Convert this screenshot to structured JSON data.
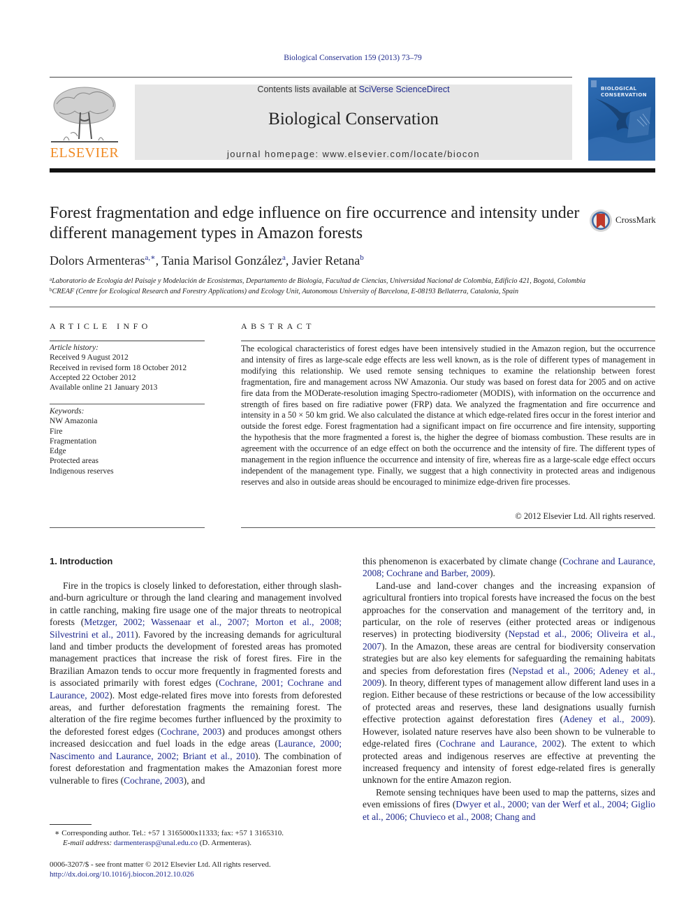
{
  "header": {
    "citation": "Biological Conservation 159 (2013) 73–79",
    "contents_prefix": "Contents lists available at ",
    "contents_link": "SciVerse ScienceDirect",
    "journal_name": "Biological Conservation",
    "homepage_prefix": "journal homepage: ",
    "homepage_url": "www.elsevier.com/locate/biocon",
    "publisher_logo_text": "ELSEVIER",
    "cover_title_line1": "BIOLOGICAL",
    "cover_title_line2": "CONSERVATION",
    "crossmark_label": "CrossMark"
  },
  "article": {
    "title": "Forest fragmentation and edge influence on fire occurrence and intensity under different management types in Amazon forests",
    "authors": [
      {
        "name": "Dolors Armenteras",
        "sup": "a,∗"
      },
      {
        "name": "Tania Marisol González",
        "sup": "a"
      },
      {
        "name": "Javier Retana",
        "sup": "b"
      }
    ],
    "affiliations": [
      {
        "mark": "a",
        "text": "Laboratorio de Ecología del Paisaje y Modelación de Ecosistemas, Departamento de Biología, Facultad de Ciencias, Universidad Nacional de Colombia, Edificio 421, Bogotá, Colombia"
      },
      {
        "mark": "b",
        "text": "CREAF (Centre for Ecological Research and Forestry Applications) and Ecology Unit, Autonomous University of Barcelona, E-08193 Bellaterra, Catalonia, Spain"
      }
    ]
  },
  "article_info": {
    "heading": "ARTICLE INFO",
    "history_label": "Article history:",
    "history": [
      "Received 9 August 2012",
      "Received in revised form 18 October 2012",
      "Accepted 22 October 2012",
      "Available online 21 January 2013"
    ],
    "keywords_label": "Keywords:",
    "keywords": [
      "NW Amazonia",
      "Fire",
      "Fragmentation",
      "Edge",
      "Protected areas",
      "Indigenous reserves"
    ]
  },
  "abstract": {
    "heading": "ABSTRACT",
    "text": "The ecological characteristics of forest edges have been intensively studied in the Amazon region, but the occurrence and intensity of fires as large-scale edge effects are less well known, as is the role of different types of management in modifying this relationship. We used remote sensing techniques to examine the relationship between forest fragmentation, fire and management across NW Amazonia. Our study was based on forest data for 2005 and on active fire data from the MODerate-resolution imaging Spectro-radiometer (MODIS), with information on the occurrence and strength of fires based on fire radiative power (FRP) data. We analyzed the fragmentation and fire occurrence and intensity in a 50 × 50 km grid. We also calculated the distance at which edge-related fires occur in the forest interior and outside the forest edge. Forest fragmentation had a significant impact on fire occurrence and fire intensity, supporting the hypothesis that the more fragmented a forest is, the higher the degree of biomass combustion. These results are in agreement with the occurrence of an edge effect on both the occurrence and the intensity of fire. The different types of management in the region influence the occurrence and intensity of fire, whereas fire as a large-scale edge effect occurs independent of the management type. Finally, we suggest that a high connectivity in protected areas and indigenous reserves and also in outside areas should be encouraged to minimize edge-driven fire processes.",
    "copyright": "© 2012 Elsevier Ltd. All rights reserved."
  },
  "introduction": {
    "heading": "1. Introduction",
    "left_column": [
      [
        {
          "t": "Fire in the tropics is closely linked to deforestation, either through slash-and-burn agriculture or through the land clearing and management involved in cattle ranching, making fire usage one of the major threats to neotropical forests ("
        },
        {
          "l": "Metzger, 2002; Wassenaar et al., 2007; Morton et al., 2008; Silvestrini et al., 2011"
        },
        {
          "t": "). Favored by the increasing demands for agricultural land and timber products the development of forested areas has promoted management practices that increase the risk of forest fires. Fire in the Brazilian Amazon tends to occur more frequently in fragmented forests and is associated primarily with forest edges ("
        },
        {
          "l": "Cochrane, 2001; Cochrane and Laurance, 2002"
        },
        {
          "t": "). Most edge-related fires move into forests from deforested areas, and further deforestation fragments the remaining forest. The alteration of the fire regime becomes further influenced by the proximity to the deforested forest edges ("
        },
        {
          "l": "Cochrane, 2003"
        },
        {
          "t": ") and produces amongst others increased desiccation and fuel loads in the edge areas ("
        },
        {
          "l": "Laurance, 2000; Nascimento and Laurance, 2002; Briant et al., 2010"
        },
        {
          "t": "). The combination of forest deforestation and fragmentation makes the Amazonian forest more vulnerable to fires ("
        },
        {
          "l": "Cochrane, 2003"
        },
        {
          "t": "), and"
        }
      ]
    ],
    "right_column": [
      [
        {
          "t": "this phenomenon is exacerbated by climate change ("
        },
        {
          "l": "Cochrane and Laurance, 2008; Cochrane and Barber, 2009"
        },
        {
          "t": ")."
        }
      ],
      [
        {
          "t": "Land-use and land-cover changes and the increasing expansion of agricultural frontiers into tropical forests have increased the focus on the best approaches for the conservation and management of the territory and, in particular, on the role of reserves (either protected areas or indigenous reserves) in protecting biodiversity ("
        },
        {
          "l": "Nepstad et al., 2006; Oliveira et al., 2007"
        },
        {
          "t": "). In the Amazon, these areas are central for biodiversity conservation strategies but are also key elements for safeguarding the remaining habitats and species from deforestation fires ("
        },
        {
          "l": "Nepstad et al., 2006; Adeney et al., 2009"
        },
        {
          "t": "). In theory, different types of management allow different land uses in a region. Either because of these restrictions or because of the low accessibility of protected areas and reserves, these land designations usually furnish effective protection against deforestation fires ("
        },
        {
          "l": "Adeney et al., 2009"
        },
        {
          "t": "). However, isolated nature reserves have also been shown to be vulnerable to edge-related fires ("
        },
        {
          "l": "Cochrane and Laurance, 2002"
        },
        {
          "t": "). The extent to which protected areas and indigenous reserves are effective at preventing the increased frequency and intensity of forest edge-related fires is generally unknown for the entire Amazon region."
        }
      ],
      [
        {
          "t": "Remote sensing techniques have been used to map the patterns, sizes and even emissions of fires ("
        },
        {
          "l": "Dwyer et al., 2000; van der Werf et al., 2004; Giglio et al., 2006; Chuvieco et al., 2008; Chang and"
        }
      ]
    ]
  },
  "footnotes": {
    "corresponding": "∗ Corresponding author. Tel.: +57 1 3165000x11333; fax: +57 1 3165310.",
    "email_label": "E-mail address: ",
    "email": "darmenterasp@unal.edu.co",
    "email_suffix": " (D. Armenteras).",
    "issn": "0006-3207/$ - see front matter © 2012 Elsevier Ltd. All rights reserved.",
    "doi": "http://dx.doi.org/10.1016/j.biocon.2012.10.026"
  },
  "colors": {
    "link": "#1f2a8c",
    "elsevier_orange": "#f08a24",
    "header_box": "#e6e6e6",
    "cover_blue": "#2a64ad"
  }
}
